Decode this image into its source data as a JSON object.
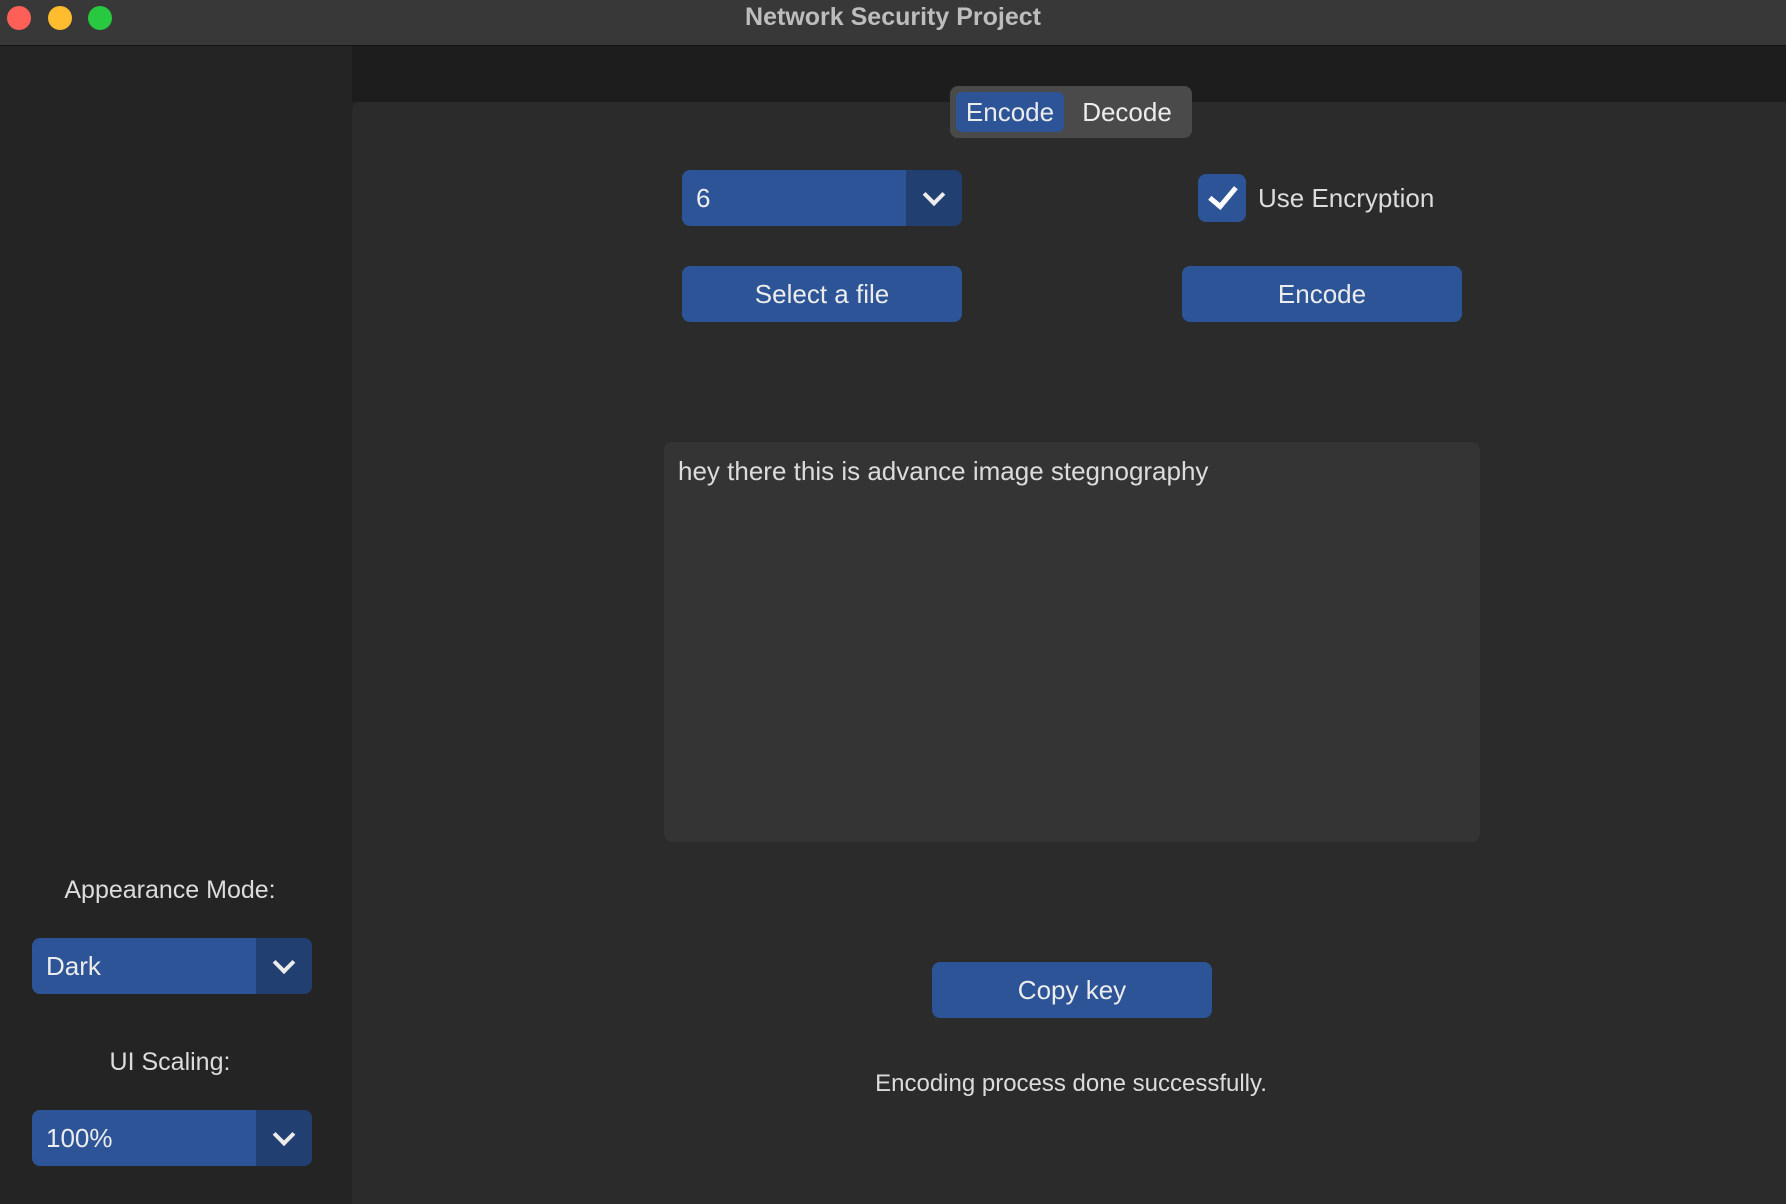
{
  "window": {
    "title": "Network Security Project"
  },
  "tabs": {
    "encode_label": "Encode",
    "decode_label": "Decode",
    "active": "Encode"
  },
  "controls": {
    "bits_value": "6",
    "use_encryption_label": "Use Encryption",
    "use_encryption_checked": true,
    "select_file_label": "Select a file",
    "encode_button_label": "Encode",
    "message_text": "hey there this is advance image stegnography",
    "copy_key_label": "Copy key",
    "status_text": "Encoding process done successfully."
  },
  "sidebar": {
    "appearance_label": "Appearance Mode:",
    "appearance_value": "Dark",
    "scaling_label": "UI Scaling:",
    "scaling_value": "100%"
  },
  "colors": {
    "accent": "#2c5496",
    "accent_dark": "#223f72",
    "background": "#242424",
    "panel": "#2b2b2b",
    "textbox": "#343434",
    "titlebar": "#383838"
  },
  "icons": {
    "dropdown": "chevron-down-icon",
    "checkbox": "checkmark-icon"
  }
}
